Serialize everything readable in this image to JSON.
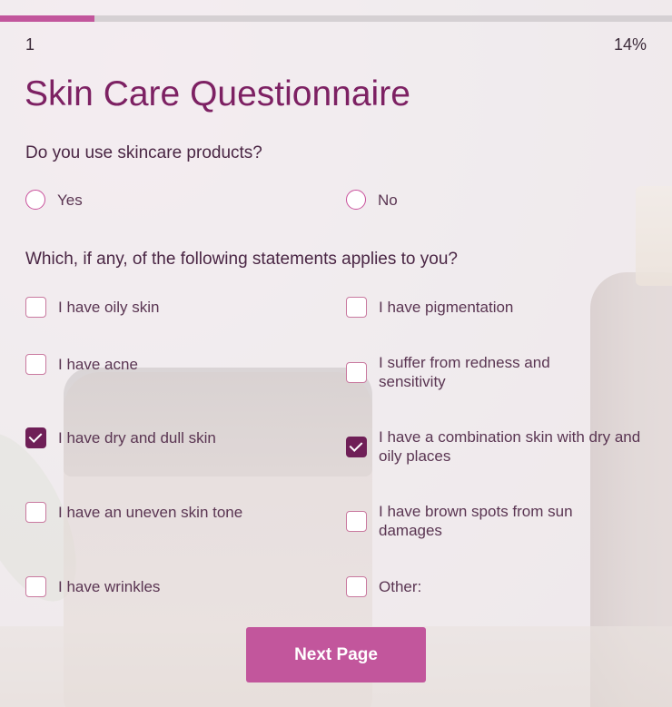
{
  "progress": {
    "page": "1",
    "percent_label": "14%",
    "value": 0.14
  },
  "title": "Skin Care Questionnaire",
  "question1": {
    "text": "Do you use skincare products?",
    "options": [
      {
        "label": "Yes",
        "selected": false
      },
      {
        "label": "No",
        "selected": false
      }
    ]
  },
  "question2": {
    "text": "Which, if any, of the following statements applies to you?",
    "options": [
      {
        "label": "I have oily skin",
        "checked": false
      },
      {
        "label": "I have pigmentation",
        "checked": false
      },
      {
        "label": "I have acne",
        "checked": false
      },
      {
        "label": "I suffer from redness and sensitivity",
        "checked": false
      },
      {
        "label": "I have dry and dull skin",
        "checked": true
      },
      {
        "label": "I have a combination skin with dry and oily places",
        "checked": true
      },
      {
        "label": "I have an uneven skin tone",
        "checked": false
      },
      {
        "label": "I have brown spots from sun damages",
        "checked": false
      },
      {
        "label": "I have wrinkles",
        "checked": false
      },
      {
        "label": "Other:",
        "checked": false
      }
    ]
  },
  "next_button": {
    "label": "Next Page"
  },
  "colors": {
    "accent": "#c2569c",
    "title": "#7d2163",
    "checked": "#6f1f57"
  }
}
